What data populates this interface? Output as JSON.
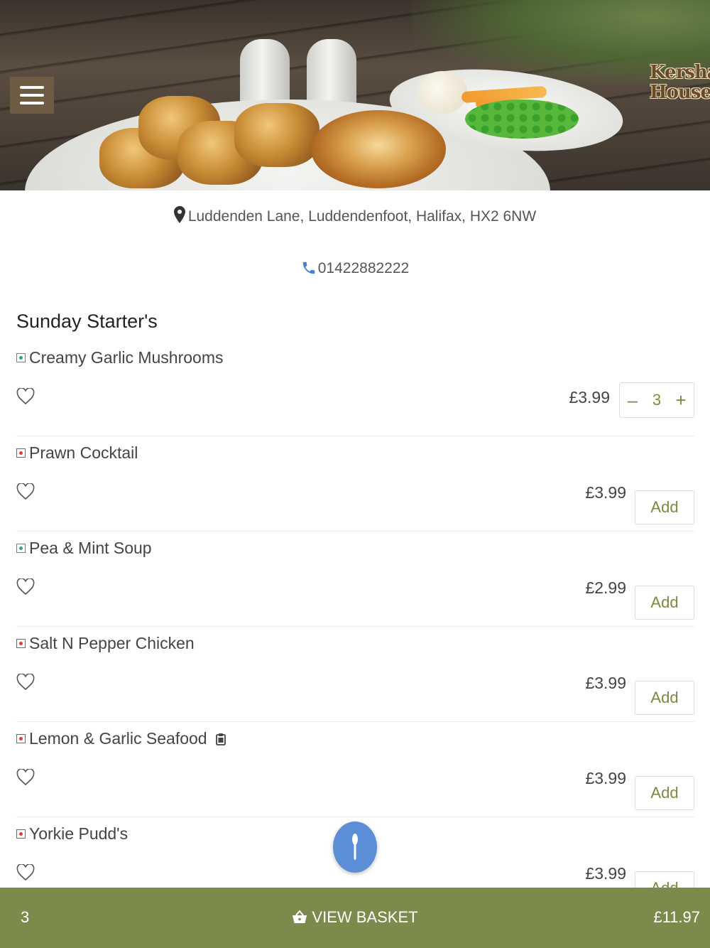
{
  "header": {
    "logo_text_line1": "Kershaw",
    "logo_text_line2": "House",
    "menu_icon": "hamburger-icon"
  },
  "info": {
    "address": "Luddenden Lane, Luddendenfoot, Halifax, HX2 6NW",
    "phone": "01422882222",
    "address_icon": "map-pin-icon",
    "phone_icon": "phone-icon",
    "phone_icon_color": "#4a7fd0"
  },
  "menu": {
    "section_title": "Sunday Starter's",
    "add_label": "Add",
    "items": [
      {
        "name": "Creamy Garlic Mushrooms",
        "diet": "veg",
        "price": "£3.99",
        "quantity": "3"
      },
      {
        "name": "Prawn Cocktail",
        "diet": "nonveg",
        "price": "£3.99"
      },
      {
        "name": "Pea & Mint Soup",
        "diet": "veg",
        "price": "£2.99"
      },
      {
        "name": "Salt N Pepper Chicken",
        "diet": "nonveg",
        "price": "£3.99"
      },
      {
        "name": "Lemon & Garlic Seafood",
        "diet": "nonveg",
        "price": "£3.99",
        "has_note_icon": true
      },
      {
        "name": "Yorkie Pudd's",
        "diet": "nonveg",
        "price": "£3.99"
      }
    ]
  },
  "basket": {
    "count": "3",
    "label": "VIEW BASKET",
    "total": "£11.97",
    "bar_color": "#7c8a4c"
  },
  "colors": {
    "accent": "#7c8a3f",
    "veg": "#2ea865",
    "nonveg": "#e53935",
    "fab": "#5b8ed6"
  }
}
